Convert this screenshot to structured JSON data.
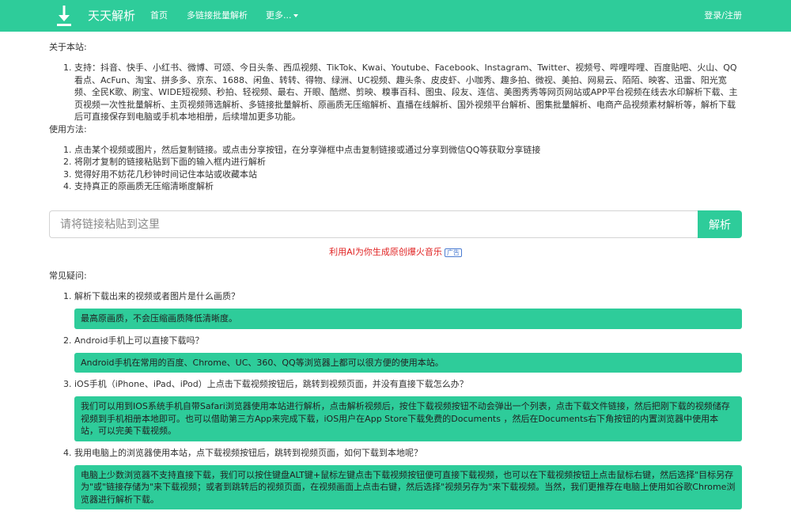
{
  "navbar": {
    "brand": "天天解析",
    "links": {
      "home": "首页",
      "batch": "多链接批量解析",
      "more": "更多..."
    },
    "login": "登录/注册",
    "accent_color": "#2ecc9a"
  },
  "about": {
    "title": "关于本站:",
    "items": [
      "支持：抖音、快手、小红书、微博、可颂、今日头条、西瓜视频、TikTok、Kwai、Youtube、Facebook、Instagram、Twitter、视频号、哔哩哔哩、百度贴吧、火山、QQ看点、AcFun、淘宝、拼多多、京东、1688、闲鱼、转转、得物、绿洲、UC视频、趣头条、皮皮虾、小咖秀、趣多拍、微视、美拍、网易云、陌陌、映客、迅雷、阳光宽频、全民K歌、刷宝、WIDE短视频、秒拍、轻视频、最右、开眼、酷燃、剪映、糗事百科、图虫、段友、连信、美图秀秀等网页网站或APP平台视频在线去水印解析下载、主页视频一次性批量解析、主页视频筛选解析、多链接批量解析、原画质无压缩解析、直播在线解析、国外视频平台解析、图集批量解析、电商产品视频素材解析等，解析下载后可直接保存到电脑或手机本地相册，后续增加更多功能。"
    ]
  },
  "usage": {
    "title": "使用方法:",
    "items": [
      "点击某个视频或图片，然后复制链接。或点击分享按钮，在分享弹框中点击复制链接或通过分享到微信QQ等获取分享链接",
      "将刚才复制的链接粘贴到下面的输入框内进行解析",
      "觉得好用不妨花几秒钟时间记住本站或收藏本站",
      "支持真正的原画质无压缩清晰度解析"
    ]
  },
  "search": {
    "placeholder": "请将链接粘贴到这里",
    "value": "",
    "button": "解析"
  },
  "ad": {
    "text": "利用AI为你生成原创爆火音乐",
    "badge": "广告"
  },
  "faq": {
    "title": "常见疑问:",
    "items": [
      {
        "q": "解析下载出来的视频或者图片是什么画质？",
        "a": "最高原画质，不会压缩画质降低清晰度。"
      },
      {
        "q": "Android手机上可以直接下载吗？",
        "a": "Android手机在常用的百度、Chrome、UC、360、QQ等浏览器上都可以很方便的使用本站。"
      },
      {
        "q": "iOS手机（iPhone、iPad、iPod）上点击下载视频按钮后，跳转到视频页面，并没有直接下载怎么办？",
        "a": "我们可以用到IOS系统手机自带Safari浏览器使用本站进行解析，点击解析视频后，按住下载视频按钮不动会弹出一个列表，点击下载文件链接，然后把刚下载的视频储存视频到手机相册本地即可。也可以借助第三方App来完成下载，iOS用户在App Store下载免费的Documents ，然后在Documents右下角按钮的内置浏览器中使用本站，可以完美下载视频。"
      },
      {
        "q": "我用电脑上的浏览器使用本站，点下载视频按钮后，跳转到视频页面，如何下载到本地呢？",
        "a": "电脑上少数浏览器不支持直接下载，我们可以按住键盘ALT键+鼠标左键点击下载视频按钮便可直接下载视频，也可以在下载视频按钮上点击鼠标右键，然后选择\"目标另存为\"或\"链接存储为\"来下载视频；或者到跳转后的视频页面，在视频画面上点击右键，然后选择\"视频另存为\"来下载视频。当然，我们更推荐在电脑上使用如谷歌Chrome浏览器进行解析下载。"
      }
    ]
  }
}
